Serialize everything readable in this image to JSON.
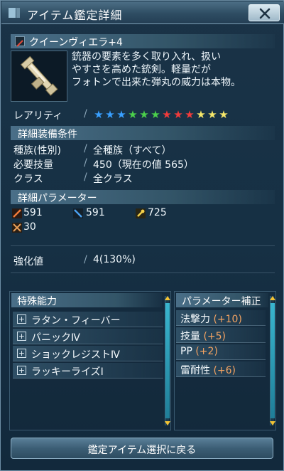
{
  "window": {
    "title": "アイテム鑑定詳細",
    "close_icon": "close-x-icon"
  },
  "item": {
    "name": "クイーンヴィエラ+4",
    "description": [
      "銃器の要素を多く取り入れ、扱い",
      "やすさを高めた銃剣。軽量だが",
      "フォトンで出来た弾丸の威力は本物。"
    ],
    "rarity_label": "レアリティ",
    "rarity_stars": [
      {
        "color": "#39a0ff"
      },
      {
        "color": "#39a0ff"
      },
      {
        "color": "#39a0ff"
      },
      {
        "color": "#4bd04b"
      },
      {
        "color": "#4bd04b"
      },
      {
        "color": "#4bd04b"
      },
      {
        "color": "#f23b3b"
      },
      {
        "color": "#f23b3b"
      },
      {
        "color": "#f23b3b"
      },
      {
        "color": "#f7e86a"
      },
      {
        "color": "#f7e86a"
      },
      {
        "color": "#f7e86a"
      }
    ]
  },
  "equip_conditions": {
    "header": "詳細装備条件",
    "rows": [
      {
        "label": "種族(性別)",
        "value": "全種族（すべて）"
      },
      {
        "label": "必要技量",
        "value": "450（現在の値 565）"
      },
      {
        "label": "クラス",
        "value": "全クラス"
      }
    ]
  },
  "parameters": {
    "header": "詳細パラメーター",
    "stats": [
      {
        "icon": "melee-attack-icon",
        "value": "591"
      },
      {
        "icon": "ranged-attack-icon",
        "value": "591"
      },
      {
        "icon": "tech-attack-icon",
        "value": "725"
      },
      {
        "icon": "dexterity-icon",
        "value": "30"
      }
    ]
  },
  "grind": {
    "label": "強化値",
    "value": "4(130%)"
  },
  "special_abilities": {
    "header": "特殊能力",
    "items": [
      "ラタン・フィーバー",
      "パニックⅣ",
      "ショックレジストⅣ",
      "ラッキーライズⅠ"
    ]
  },
  "param_bonus": {
    "header": "パラメーター補正",
    "items": [
      {
        "label": "法撃力",
        "value": "(+10)"
      },
      {
        "label": "技量",
        "value": "(+5)"
      },
      {
        "label": "PP",
        "value": "(+2)"
      },
      {
        "label": "雷耐性",
        "value": "(+6)"
      }
    ]
  },
  "footer": {
    "back_button": "鑑定アイテム選択に戻る"
  },
  "colors": {
    "accent_orange": "#f5a462",
    "panel_bg": "#163044",
    "scroll_cyan": "#39b6cf"
  }
}
